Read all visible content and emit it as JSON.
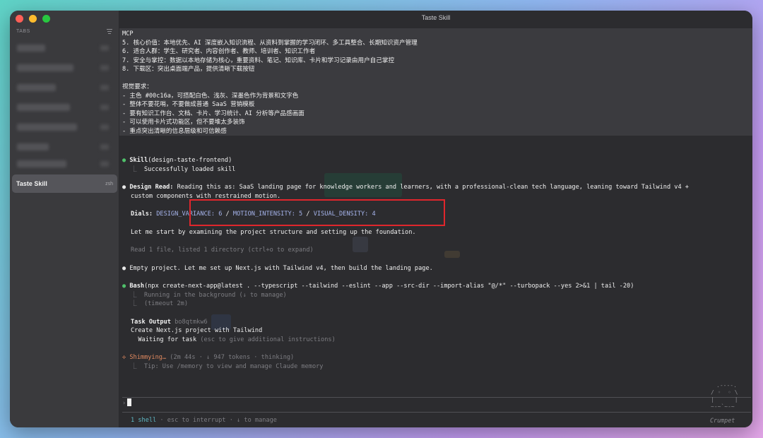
{
  "window": {
    "title": "Taste Skill"
  },
  "sidebar": {
    "tabs_header": "TABS",
    "active_tab": {
      "label": "Taste Skill",
      "shell": "zsh"
    }
  },
  "prompt": {
    "lines": [
      "MCP",
      "5. 核心价值：本地优先、AI 深度嵌入知识流程、从资料到掌握的学习闭环、多工具整合、长期知识资产管理",
      "6. 适合人群：学生、研究者、内容创作者、教师、培训者、知识工作者",
      "7. 安全与掌控：数据以本地存储为核心，重要资料、笔记、知识库、卡片和学习记录由用户自己掌控",
      "8. 下载区：突出桌面端产品，提供清晰下载按钮",
      "",
      "视觉要求：",
      "- 主色 #00c16a，可搭配白色、浅灰、深墨色作为背景和文字色",
      "- 整体不要花哨，不要做成普通 SaaS 营销模板",
      "- 要有知识工作台、文档、卡片、学习统计、AI 分析等产品感画面",
      "- 可以使用卡片式功能区，但不要堆太多装饰",
      "- 重点突出清晰的信息层级和可信赖感"
    ]
  },
  "transcript": {
    "skill": {
      "bullet": "●",
      "name": "Skill",
      "arg": "(design-taste-frontend)",
      "result_prefix": "⎿",
      "result": "Successfully loaded skill"
    },
    "design_read": {
      "bullet": "●",
      "label": "Design Read:",
      "line1": " Reading this as: SaaS landing page for knowledge workers and learners, with a professional-clean tech language, leaning toward Tailwind v4 +",
      "line2": "custom components with restrained motion."
    },
    "dials": {
      "label": "Dials:",
      "v1": "DESIGN_VARIANCE: 6",
      "sep1": " / ",
      "v2": "MOTION_INTENSITY: 5",
      "sep2": " / ",
      "v3": "VISUAL_DENSITY: 4"
    },
    "start_text": "Let me start by examining the project structure and setting up the foundation.",
    "read_text": "Read 1 file, listed 1 directory (ctrl+o to expand)",
    "empty_project": {
      "bullet": "●",
      "text": "Empty project. Let me set up Next.js with Tailwind v4, then build the landing page."
    },
    "bash": {
      "bullet": "●",
      "name": "Bash",
      "command": "(npx create-next-app@latest . --typescript --tailwind --eslint --app --src-dir --import-alias \"@/*\" --turbopack --yes 2>&1 | tail -20)",
      "line1": "⎿  Running in the background (↓ to manage)",
      "line2": "⎿  (timeout 2m)"
    },
    "task_output": {
      "label": "Task Output",
      "id": " bo8qtmkw6",
      "line1": "Create Next.js project with Tailwind",
      "line2_main": "  Waiting for task",
      "line2_dim": " (esc to give additional instructions)"
    },
    "status": {
      "star": "✢",
      "word": "Shimmying…",
      "detail": " (2m 44s · ↓ 947 tokens · thinking)",
      "tip": "⎿  Tip: Use /memory to view and manage Claude memory"
    }
  },
  "input": {
    "prompt_symbol": "›"
  },
  "footer": {
    "shell_count": "1 shell",
    "hint": " · esc to interrupt · ↓ to manage",
    "mascot_name": "Crumpet"
  },
  "mascot_ascii": [
    ".----.",
    "/ ◦  ◦ \\",
    "|      |",
    "~-~`~-~"
  ],
  "colors": {
    "accent_green": "#4fc06a",
    "dial_blue": "#a6b4ec",
    "status_orange": "#e0895f",
    "highlight_red": "#e0262c"
  }
}
